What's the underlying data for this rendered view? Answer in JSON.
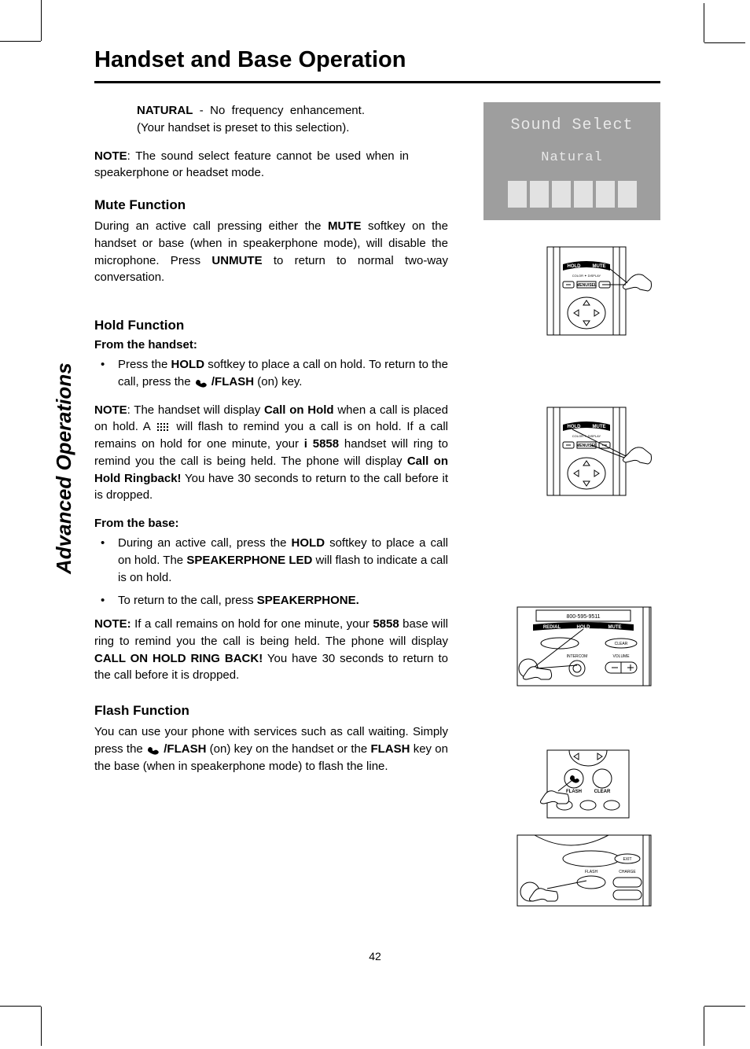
{
  "title": "Handset and Base Operation",
  "section_tab": "Advanced Operations",
  "page_number": "42",
  "lcd": {
    "line1": "Sound Select",
    "line2": "Natural"
  },
  "natural": {
    "label": "NATURAL",
    "desc": " - No frequency enhancement. (Your handset is preset to this selection)."
  },
  "note_sound": {
    "label": "NOTE",
    "text": ": The sound select feature cannot be used when in speakerphone or headset mode."
  },
  "mute": {
    "heading": "Mute Function",
    "p1a": "During an active call pressing either the ",
    "p1b": "MUTE",
    "p1c": " softkey on the handset or  base (when in speakerphone mode), will disable the microphone. Press ",
    "p1d": "UNMUTE",
    "p1e": " to return to normal two-way conversation."
  },
  "hold": {
    "heading": "Hold Function",
    "from_handset": "From the handset:",
    "li1a": "Press the ",
    "li1b": "HOLD",
    "li1c": " softkey to place a call on hold. To return to the call, press the ",
    "li1d": " /FLASH",
    "li1e": " (on) key.",
    "note1a": "NOTE",
    "note1b": ": The handset will display ",
    "note1c": "Call on Hold",
    "note1d": " when a call is placed on hold. A ",
    "note1e": " will flash to remind you a call is on hold. If a call remains on hold for one minute, your ",
    "note1f": "i 5858",
    "note1g": " handset will ring to remind you the call is being held. The phone will display ",
    "note1h": "Call on Hold Ringback!",
    "note1i": " You have 30 seconds to return to the call before it is dropped.",
    "from_base": "From the base:",
    "li2a": "During an active call, press the ",
    "li2b": "HOLD",
    "li2c": " softkey  to place a call on hold. The ",
    "li2d": "SPEAKERPHONE LED",
    "li2e": " will flash to indicate a call is on hold.",
    "li3a": "To return to the call, press  ",
    "li3b": "SPEAKERPHONE.",
    "note2a": "NOTE:",
    "note2b": " If a call remains on hold for one minute, your ",
    "note2c": " 5858",
    "note2d": " base will ring to remind you the call is being held. The phone will display ",
    "note2e": "CALL ON HOLD  RING BACK!",
    "note2f": " You have 30 seconds to return to the call before it is dropped."
  },
  "flash": {
    "heading": "Flash Function",
    "p1a": "You can use your phone with services such as call waiting. Simply press the ",
    "p1b": " /FLASH",
    "p1c": " (on) key on the handset or the ",
    "p1d": "FLASH",
    "p1e": "  key on the base (when in speakerphone mode) to flash the line."
  },
  "fig_labels": {
    "hold": "HOLD",
    "mute": "MUTE",
    "menu_sel": "MENU/SEL",
    "color_display": "COLOR ✦ DISPLAY",
    "redial": "REDIAL",
    "clear": "CLEAR",
    "intercom": "INTERCOM",
    "volume": "VOLUME",
    "flash": "FLASH",
    "exit": "EXIT",
    "charge": "CHARGE",
    "phone_number": "800-595-9511"
  }
}
